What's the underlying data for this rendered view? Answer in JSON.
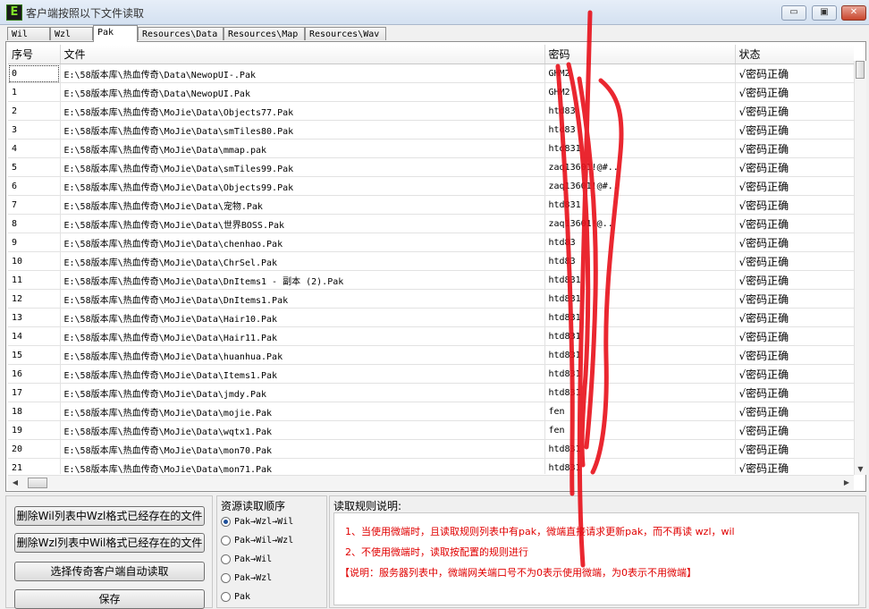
{
  "window": {
    "title": "客户端按照以下文件读取",
    "icon_letter": "E",
    "min_glyph": "▭",
    "max_glyph": "▣",
    "close_glyph": "✕"
  },
  "tabs": [
    {
      "label": "Wil"
    },
    {
      "label": "Wzl"
    },
    {
      "label": "Pak"
    },
    {
      "label": "Resources\\Data"
    },
    {
      "label": "Resources\\Map"
    },
    {
      "label": "Resources\\Wav"
    }
  ],
  "active_tab": "Pak",
  "table": {
    "columns": [
      "序号",
      "文件",
      "密码",
      "状态"
    ],
    "rows": [
      {
        "index": "0",
        "file": "E:\\58版本库\\热血传奇\\Data\\NewopUI-.Pak",
        "password": "GHM2",
        "status": "√密码正确"
      },
      {
        "index": "1",
        "file": "E:\\58版本库\\热血传奇\\Data\\NewopUI.Pak",
        "password": "GHM2",
        "status": "√密码正确"
      },
      {
        "index": "2",
        "file": "E:\\58版本库\\热血传奇\\MoJie\\Data\\Objects77.Pak",
        "password": "htd83",
        "status": "√密码正确"
      },
      {
        "index": "3",
        "file": "E:\\58版本库\\热血传奇\\MoJie\\Data\\smTiles80.Pak",
        "password": "htd83",
        "status": "√密码正确"
      },
      {
        "index": "4",
        "file": "E:\\58版本库\\热血传奇\\MoJie\\Data\\mmap.pak",
        "password": "htd831",
        "status": "√密码正确"
      },
      {
        "index": "5",
        "file": "E:\\58版本库\\热血传奇\\MoJie\\Data\\smTiles99.Pak",
        "password": "zaq13601!@#..",
        "status": "√密码正确"
      },
      {
        "index": "6",
        "file": "E:\\58版本库\\热血传奇\\MoJie\\Data\\Objects99.Pak",
        "password": "zaq13601!@#..",
        "status": "√密码正确"
      },
      {
        "index": "7",
        "file": "E:\\58版本库\\热血传奇\\MoJie\\Data\\宠物.Pak",
        "password": "htd831",
        "status": "√密码正确"
      },
      {
        "index": "8",
        "file": "E:\\58版本库\\热血传奇\\MoJie\\Data\\世界BOSS.Pak",
        "password": "zaq13601!@..",
        "status": "√密码正确"
      },
      {
        "index": "9",
        "file": "E:\\58版本库\\热血传奇\\MoJie\\Data\\chenhao.Pak",
        "password": "htd83",
        "status": "√密码正确"
      },
      {
        "index": "10",
        "file": "E:\\58版本库\\热血传奇\\MoJie\\Data\\ChrSel.Pak",
        "password": "htd83",
        "status": "√密码正确"
      },
      {
        "index": "11",
        "file": "E:\\58版本库\\热血传奇\\MoJie\\Data\\DnItems1 - 副本 (2).Pak",
        "password": "htd831",
        "status": "√密码正确"
      },
      {
        "index": "12",
        "file": "E:\\58版本库\\热血传奇\\MoJie\\Data\\DnItems1.Pak",
        "password": "htd831",
        "status": "√密码正确"
      },
      {
        "index": "13",
        "file": "E:\\58版本库\\热血传奇\\MoJie\\Data\\Hair10.Pak",
        "password": "htd831",
        "status": "√密码正确"
      },
      {
        "index": "14",
        "file": "E:\\58版本库\\热血传奇\\MoJie\\Data\\Hair11.Pak",
        "password": "htd831",
        "status": "√密码正确"
      },
      {
        "index": "15",
        "file": "E:\\58版本库\\热血传奇\\MoJie\\Data\\huanhua.Pak",
        "password": "htd831",
        "status": "√密码正确"
      },
      {
        "index": "16",
        "file": "E:\\58版本库\\热血传奇\\MoJie\\Data\\Items1.Pak",
        "password": "htd831",
        "status": "√密码正确"
      },
      {
        "index": "17",
        "file": "E:\\58版本库\\热血传奇\\MoJie\\Data\\jmdy.Pak",
        "password": "htd831",
        "status": "√密码正确"
      },
      {
        "index": "18",
        "file": "E:\\58版本库\\热血传奇\\MoJie\\Data\\mojie.Pak",
        "password": "fen",
        "status": "√密码正确"
      },
      {
        "index": "19",
        "file": "E:\\58版本库\\热血传奇\\MoJie\\Data\\wqtx1.Pak",
        "password": "fen",
        "status": "√密码正确"
      },
      {
        "index": "20",
        "file": "E:\\58版本库\\热血传奇\\MoJie\\Data\\mon70.Pak",
        "password": "htd831",
        "status": "√密码正确"
      },
      {
        "index": "21",
        "file": "E:\\58版本库\\热血传奇\\MoJie\\Data\\mon71.Pak",
        "password": "htd831",
        "status": "√密码正确"
      }
    ]
  },
  "scroll": {
    "up": "▲",
    "down": "▼",
    "left": "◀",
    "right": "▶"
  },
  "buttons": {
    "delete_wil": "删除Wil列表中Wzl格式已经存在的文件",
    "delete_wzl": "删除Wzl列表中Wil格式已经存在的文件",
    "auto_read": "选择传奇客户端自动读取",
    "save": "保存"
  },
  "resource_order": {
    "title": "资源读取顺序",
    "options": [
      "Pak→Wzl→Wil",
      "Pak→Wil→Wzl",
      "Pak→Wil",
      "Pak→Wzl",
      "Pak"
    ],
    "selected": "Pak→Wzl→Wil"
  },
  "rules": {
    "title": "读取规则说明:",
    "line1": "1、当使用微端时，且读取规则列表中有pak，微端直接请求更新pak，而不再读 wzl，wil",
    "line2": "2、不使用微端时，读取按配置的规则进行",
    "line3": "【说明：服务器列表中，微端网关端口号不为0表示使用微端，为0表示不用微端】"
  },
  "colors": {
    "annotation_red": "#e8101a",
    "rule_text": "#e00000"
  }
}
